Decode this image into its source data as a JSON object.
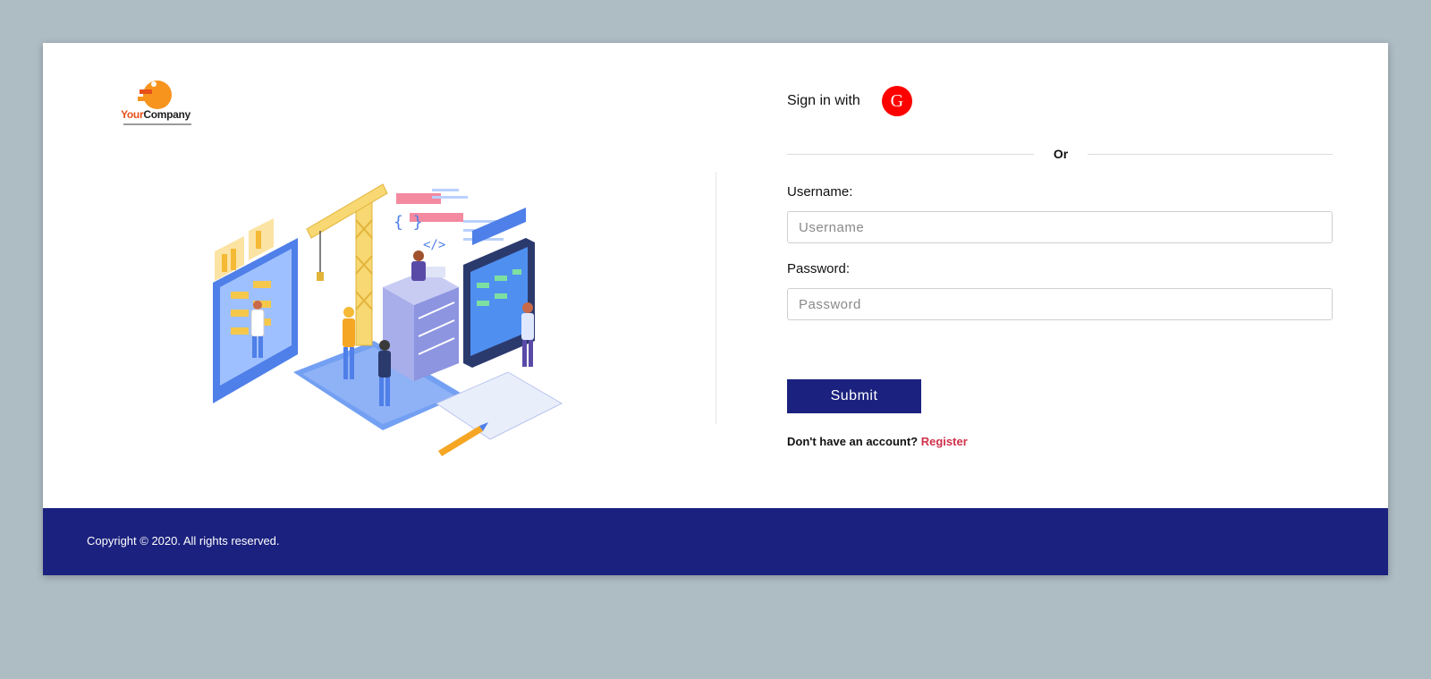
{
  "logo": {
    "brand_your": "Your",
    "brand_company": "Company"
  },
  "signin": {
    "label": "Sign in with",
    "google_letter": "G",
    "google_color": "#ff0000"
  },
  "divider": {
    "or_text": "Or"
  },
  "form": {
    "username_label": "Username:",
    "username_placeholder": "Username",
    "username_value": "",
    "password_label": "Password:",
    "password_placeholder": "Password",
    "password_value": "",
    "submit_label": "Submit"
  },
  "register": {
    "prompt": "Don't have an account?",
    "link_label": "Register",
    "link_color": "#d0304a"
  },
  "footer": {
    "copyright": "Copyright © 2020. All rights reserved.",
    "background": "#1b217e"
  },
  "colors": {
    "page_background": "#aebcc4",
    "brand_primary": "#1b217e",
    "logo_accent": "#e8501a"
  }
}
